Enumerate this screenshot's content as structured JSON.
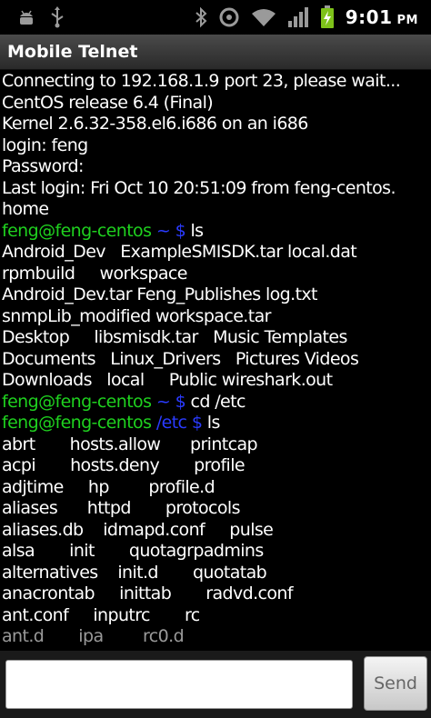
{
  "status_bar": {
    "time": "9:01",
    "ampm": "PM"
  },
  "app": {
    "title": "Mobile Telnet"
  },
  "terminal": {
    "lines": [
      [
        {
          "t": "Connecting to 192.168.1.9 port 23, please wait...",
          "c": "w"
        }
      ],
      [
        {
          "t": "CentOS release 6.4 (Final)",
          "c": "w"
        }
      ],
      [
        {
          "t": "Kernel 2.6.32-358.el6.i686 on an i686",
          "c": "w"
        }
      ],
      [
        {
          "t": "login: feng",
          "c": "w"
        }
      ],
      [
        {
          "t": "Password:",
          "c": "w"
        }
      ],
      [
        {
          "t": "Last login: Fri Oct 10 20:51:09 from feng-centos.",
          "c": "w"
        }
      ],
      [
        {
          "t": "home",
          "c": "w"
        }
      ],
      [
        {
          "t": "feng@feng-centos",
          "c": "u"
        },
        {
          "t": " ~ $",
          "c": "d"
        },
        {
          "t": " ls",
          "c": "w"
        }
      ],
      [
        {
          "t": "Android_Dev   ExampleSMISDK.tar local.dat",
          "c": "w"
        }
      ],
      [
        {
          "t": "rpmbuild     workspace",
          "c": "w"
        }
      ],
      [
        {
          "t": "Android_Dev.tar Feng_Publishes log.txt",
          "c": "w"
        }
      ],
      [
        {
          "t": "snmpLib_modified workspace.tar",
          "c": "w"
        }
      ],
      [
        {
          "t": "Desktop     libsmisdk.tar   Music Templates",
          "c": "w"
        }
      ],
      [
        {
          "t": "Documents   Linux_Drivers   Pictures Videos",
          "c": "w"
        }
      ],
      [
        {
          "t": "Downloads   local     Public wireshark.out",
          "c": "w"
        }
      ],
      [
        {
          "t": "feng@feng-centos",
          "c": "u"
        },
        {
          "t": " ~ $",
          "c": "d"
        },
        {
          "t": " cd /etc",
          "c": "w"
        }
      ],
      [
        {
          "t": "feng@feng-centos",
          "c": "u"
        },
        {
          "t": " /etc $",
          "c": "d"
        },
        {
          "t": " ls",
          "c": "w"
        }
      ],
      [
        {
          "t": "abrt       hosts.allow      printcap",
          "c": "w"
        }
      ],
      [
        {
          "t": "acpi       hosts.deny       profile",
          "c": "w"
        }
      ],
      [
        {
          "t": "adjtime     hp        profile.d",
          "c": "w"
        }
      ],
      [
        {
          "t": "aliases      httpd       protocols",
          "c": "w"
        }
      ],
      [
        {
          "t": "aliases.db    idmapd.conf     pulse",
          "c": "w"
        }
      ],
      [
        {
          "t": "alsa       init       quotagrpadmins",
          "c": "w"
        }
      ],
      [
        {
          "t": "alternatives    init.d       quotatab",
          "c": "w"
        }
      ],
      [
        {
          "t": "anacrontab     inittab       radvd.conf",
          "c": "w"
        }
      ],
      [
        {
          "t": "ant.conf     inputrc       rc",
          "c": "w"
        }
      ],
      [
        {
          "t": "ant.d       ipa        rc0.d",
          "c": "w"
        }
      ]
    ]
  },
  "input": {
    "value": "",
    "send_label": "Send"
  },
  "colors": {
    "prompt_user": "#1fd11f",
    "prompt_dir": "#2a3bff",
    "text": "#ffffff",
    "background": "#000000"
  }
}
